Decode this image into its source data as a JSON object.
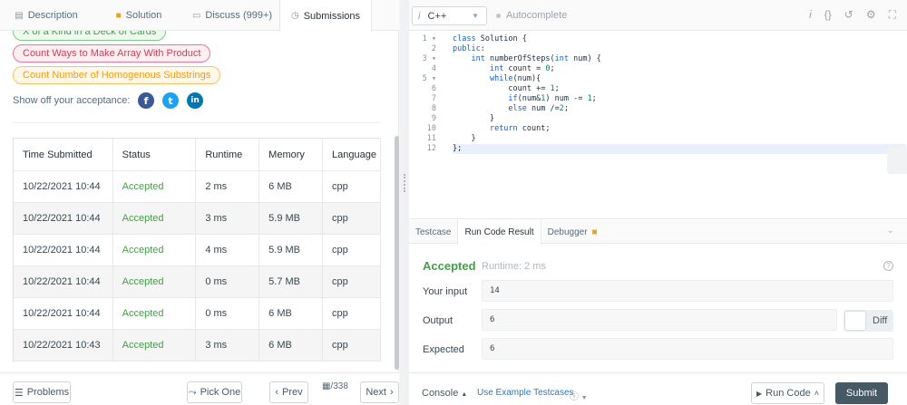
{
  "tabs": [
    {
      "icon": "document-icon",
      "glyph": "▤",
      "label": "Description"
    },
    {
      "icon": "lock-icon",
      "glyph": "🔒",
      "label": "Solution"
    },
    {
      "icon": "discuss-icon",
      "glyph": "▭",
      "label": "Discuss (999+)"
    },
    {
      "icon": "history-icon",
      "glyph": "◷",
      "label": "Submissions"
    }
  ],
  "similar_tags": [
    {
      "label": "X of a Kind in a Deck of Cards",
      "color": "green"
    },
    {
      "label": "Count Ways to Make Array With Product",
      "color": "red"
    },
    {
      "label": "Count Number of Homogenous Substrings",
      "color": "orange"
    }
  ],
  "share": {
    "label": "Show off your acceptance:"
  },
  "submissions": {
    "headers": [
      "Time Submitted",
      "Status",
      "Runtime",
      "Memory",
      "Language"
    ],
    "rows": [
      [
        "10/22/2021 10:44",
        "Accepted",
        "2 ms",
        "6 MB",
        "cpp"
      ],
      [
        "10/22/2021 10:44",
        "Accepted",
        "3 ms",
        "5.9 MB",
        "cpp"
      ],
      [
        "10/22/2021 10:44",
        "Accepted",
        "4 ms",
        "5.9 MB",
        "cpp"
      ],
      [
        "10/22/2021 10:44",
        "Accepted",
        "0 ms",
        "5.7 MB",
        "cpp"
      ],
      [
        "10/22/2021 10:44",
        "Accepted",
        "0 ms",
        "6 MB",
        "cpp"
      ],
      [
        "10/22/2021 10:43",
        "Accepted",
        "3 ms",
        "6 MB",
        "cpp"
      ]
    ]
  },
  "bottom_left": {
    "problems": "Problems",
    "pick_one": "Pick One",
    "prev": "Prev",
    "count": "/338",
    "next": "Next"
  },
  "editor": {
    "language": "C++",
    "autocomplete": "Autocomplete",
    "lines": [
      "class Solution {",
      "public:",
      "    int numberOfSteps(int num) {",
      "        int count = 0;",
      "        while(num){",
      "            count += 1;",
      "            if(num&1) num -= 1;",
      "            else num /=2;",
      "        }",
      "        return count;",
      "    }",
      "};"
    ],
    "fold_lines": [
      1,
      3,
      5
    ]
  },
  "panel": {
    "tabs": [
      "Testcase",
      "Run Code Result",
      "Debugger"
    ],
    "status": "Accepted",
    "runtime": "Runtime: 2 ms",
    "input_label": "Your input",
    "input_value": "14",
    "output_label": "Output",
    "output_value": "6",
    "expected_label": "Expected",
    "expected_value": "6",
    "diff_label": "Diff"
  },
  "bottom_right": {
    "console": "Console",
    "example": "Use Example Testcases",
    "run_code": "Run Code",
    "submit": "Submit"
  },
  "colors": {
    "accent_green": "#43a047",
    "submit_bg": "#455a64",
    "link_blue": "#2a7ab8"
  }
}
